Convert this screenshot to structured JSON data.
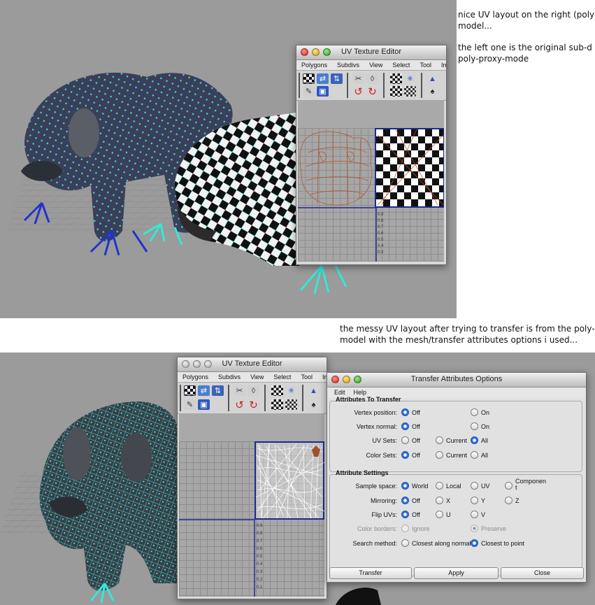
{
  "notes": {
    "top_line1": "nice UV layout on the right (polygon)",
    "top_line2": "model...",
    "top_line3": "the left one is the original sub-d in",
    "top_line4": "poly-proxy-mode",
    "bottom_line1": "the messy UV layout after trying to transfer is from the poly-",
    "bottom_line2": "model with the mesh/transfer attributes options i used..."
  },
  "uv_editor_top": {
    "title": "UV Texture Editor",
    "menus": [
      "Polygons",
      "Subdivs",
      "View",
      "Select",
      "Tool",
      "Imag"
    ]
  },
  "uv_editor_bottom": {
    "title": "UV Texture Editor",
    "menus": [
      "Polygons",
      "Subdivs",
      "View",
      "Select",
      "Tool",
      "Imag"
    ]
  },
  "uv_ticks": [
    "0.9",
    "0.8",
    "0.7",
    "0.6",
    "0.5",
    "0.4",
    "0.3",
    "0.2",
    "0.1"
  ],
  "transfer_dialog": {
    "title": "Transfer Attributes Options",
    "menus": [
      "Edit",
      "Help"
    ],
    "section1": "Attributes To Transfer",
    "vertex_position": {
      "label": "Vertex position:",
      "opt1": "Off",
      "opt2": "On"
    },
    "vertex_normal": {
      "label": "Vertex normal:",
      "opt1": "Off",
      "opt2": "On"
    },
    "uv_sets": {
      "label": "UV Sets:",
      "opt1": "Off",
      "opt2": "Current",
      "opt3": "All"
    },
    "color_sets": {
      "label": "Color Sets:",
      "opt1": "Off",
      "opt2": "Current",
      "opt3": "All"
    },
    "section2": "Attribute Settings",
    "sample_space": {
      "label": "Sample space:",
      "opt1": "World",
      "opt2": "Local",
      "opt3": "UV",
      "opt4a": "Componen",
      "opt4b": "t"
    },
    "mirroring": {
      "label": "Mirroring:",
      "opt1": "Off",
      "opt2": "X",
      "opt3": "Y",
      "opt4": "Z"
    },
    "flip_uvs": {
      "label": "Flip UVs:",
      "opt1": "Off",
      "opt2": "U",
      "opt3": "V"
    },
    "color_borders": {
      "label": "Color borders:",
      "opt1": "Ignore",
      "opt2": "Preserve"
    },
    "search_method": {
      "label": "Search method:",
      "opt1": "Closest along normal",
      "opt2": "Closest to point"
    },
    "buttons": {
      "transfer": "Transfer",
      "apply": "Apply",
      "close": "Close"
    }
  },
  "colors": {
    "viewport": "#9b9b9b",
    "wire_blue": "#2233cc",
    "wire_cyan": "#33e8d8",
    "vertex_cyan": "#3fd6ff",
    "radio_selected": "#1e56c3"
  }
}
